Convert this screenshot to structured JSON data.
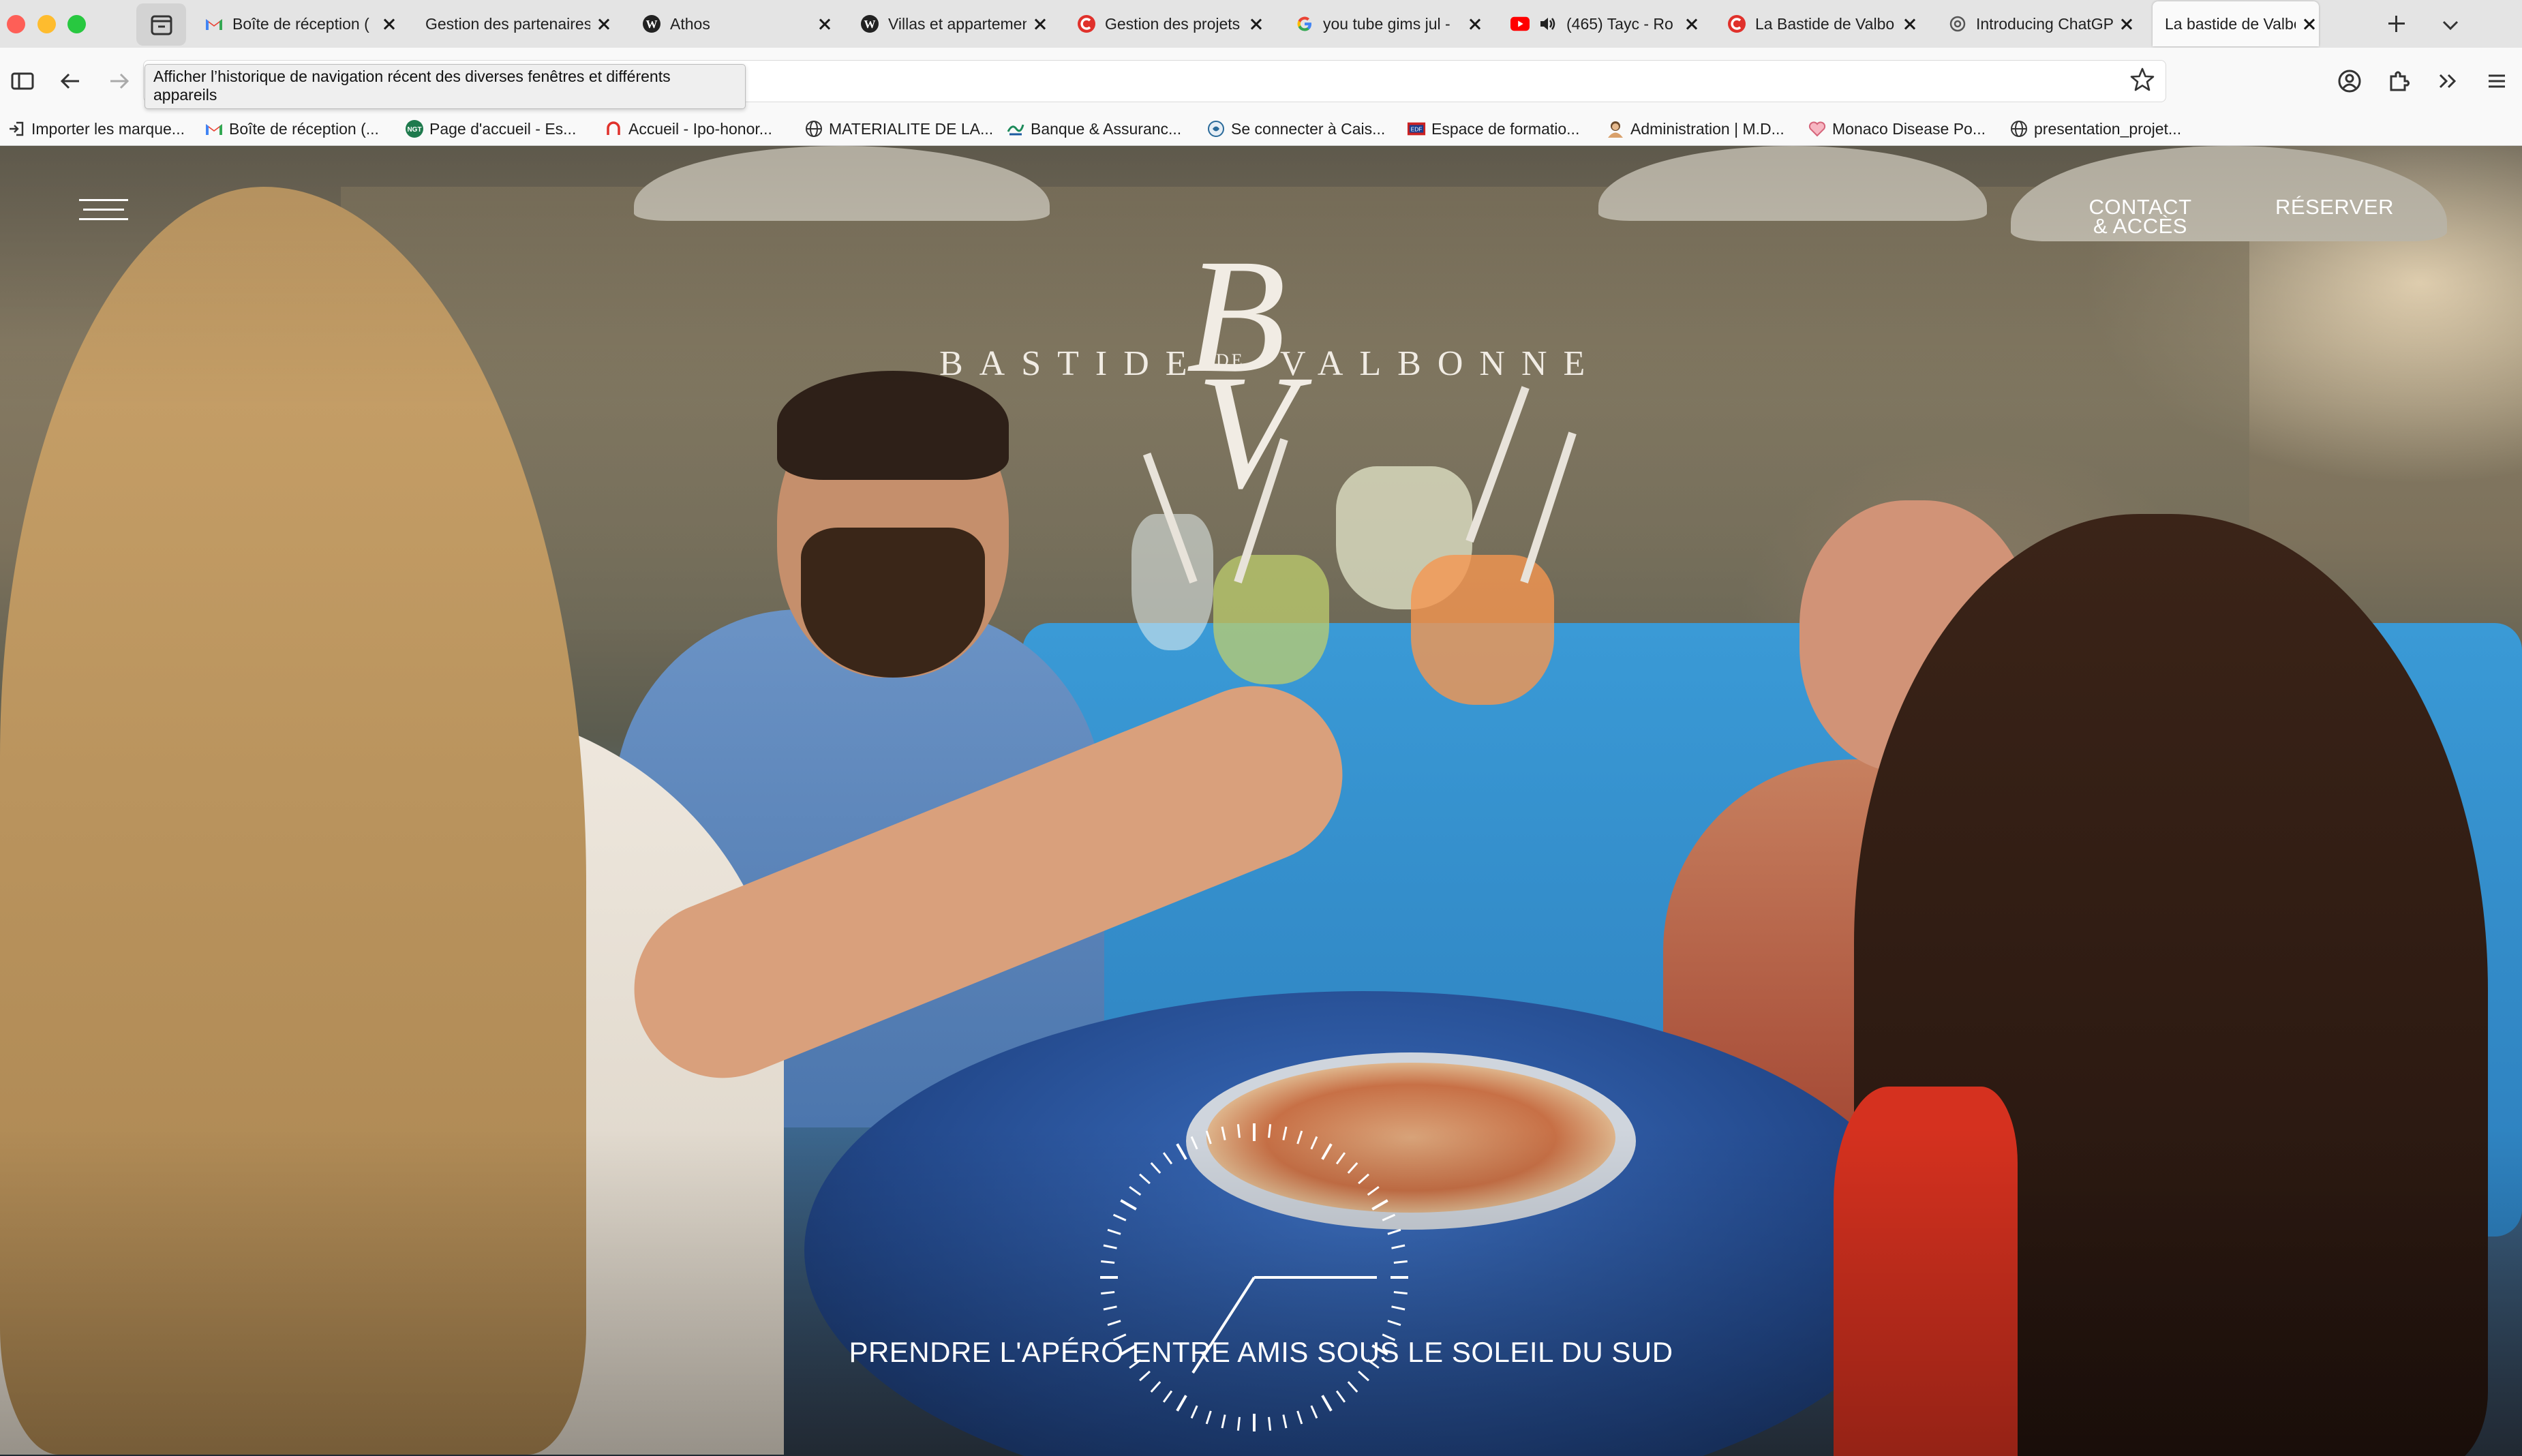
{
  "browser": {
    "tabs": [
      {
        "title": "Boîte de réception (",
        "icon": "gmail-icon",
        "active": false
      },
      {
        "title": "Gestion des partenaires",
        "icon": "none",
        "active": false
      },
      {
        "title": "Athos",
        "icon": "wordpress-icon",
        "active": false
      },
      {
        "title": "Villas et appartements",
        "icon": "wordpress-icon",
        "active": false
      },
      {
        "title": "Gestion des projets",
        "icon": "red-c-icon",
        "active": false
      },
      {
        "title": "you tube gims jul - ",
        "icon": "google-icon",
        "active": false
      },
      {
        "title": "(465) Tayc - Ro",
        "icon": "youtube-icon",
        "active": false,
        "audio": true
      },
      {
        "title": "La Bastide de Valbo",
        "icon": "red-c-icon",
        "active": false
      },
      {
        "title": "Introducing ChatGPT",
        "icon": "openai-icon",
        "active": false
      },
      {
        "title": "La bastide de Valbonne",
        "icon": "none",
        "active": true
      }
    ],
    "tooltip": "Afficher l’historique de navigation récent des diverses fenêtres et différents appareils",
    "bookmarks": [
      {
        "label": "Importer les marque...",
        "icon": "import-icon"
      },
      {
        "label": "Boîte de réception (...",
        "icon": "gmail-icon"
      },
      {
        "label": "Page d'accueil - Es...",
        "icon": "green-badge-icon"
      },
      {
        "label": "Accueil - Ipo-honor...",
        "icon": "red-arc-icon"
      },
      {
        "label": "MATERIALITE DE LA...",
        "icon": "globe-icon"
      },
      {
        "label": "Banque & Assuranc...",
        "icon": "green-wave-icon"
      },
      {
        "label": "Se connecter à Cais...",
        "icon": "caisse-icon"
      },
      {
        "label": "Espace de formatio...",
        "icon": "formation-icon"
      },
      {
        "label": "Administration | M.D...",
        "icon": "avatar-icon"
      },
      {
        "label": "Monaco Disease Po...",
        "icon": "heart-icon"
      },
      {
        "label": "presentation_projet...",
        "icon": "globe-icon"
      }
    ]
  },
  "site": {
    "logo_left": "BASTIDE",
    "logo_de": "DE",
    "logo_right": "VALBONNE",
    "contact_line1": "CONTACT",
    "contact_line2": "& ACCÈS",
    "reserve": "RÉSERVER",
    "caption": "PRENDRE L'APÉRO ENTRE AMIS SOUS LE SOLEIL DU SUD"
  },
  "colors": {
    "gmail_red": "#ea4335",
    "youtube_red": "#ff0000",
    "brand_cream": "#f1ece4",
    "pool_blue": "#3a9ad6"
  }
}
